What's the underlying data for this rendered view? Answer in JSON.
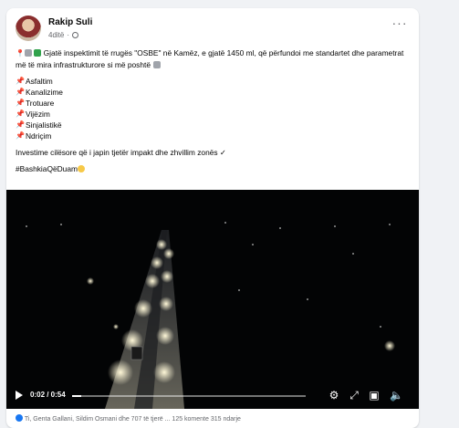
{
  "post": {
    "author": "Rakip Suli",
    "time": "4ditë",
    "more_label": "···",
    "intro": "Gjatë inspektimit të rrugës \"OSBE\" në Kamëz, e gjatë 1450 ml, që përfundoi me standartet dhe parametrat më të mira infrastrukturore si më poshtë",
    "items": [
      {
        "label": "Asfaltim"
      },
      {
        "label": "Kanalizime"
      },
      {
        "label": "Trotuare"
      },
      {
        "label": "Vijëzim"
      },
      {
        "label": "Sinjalistikë"
      },
      {
        "label": "Ndriçim"
      }
    ],
    "closing": "Investime cilësore që i japin tjetër impakt dhe zhvillim zonës ✓",
    "hashtag": "#BashkiaQëDuam"
  },
  "video": {
    "time": "0:02 / 0:54",
    "progress": 0.04
  },
  "footer": {
    "text": "Ti, Genta Gallani, Sildim Osmani dhe 707 të tjerë ... 125 komente 315 ndarje"
  },
  "colors": {
    "accent": "#1877f2",
    "text": "#050505",
    "muted": "#65676b",
    "background": "#f0f2f5"
  }
}
